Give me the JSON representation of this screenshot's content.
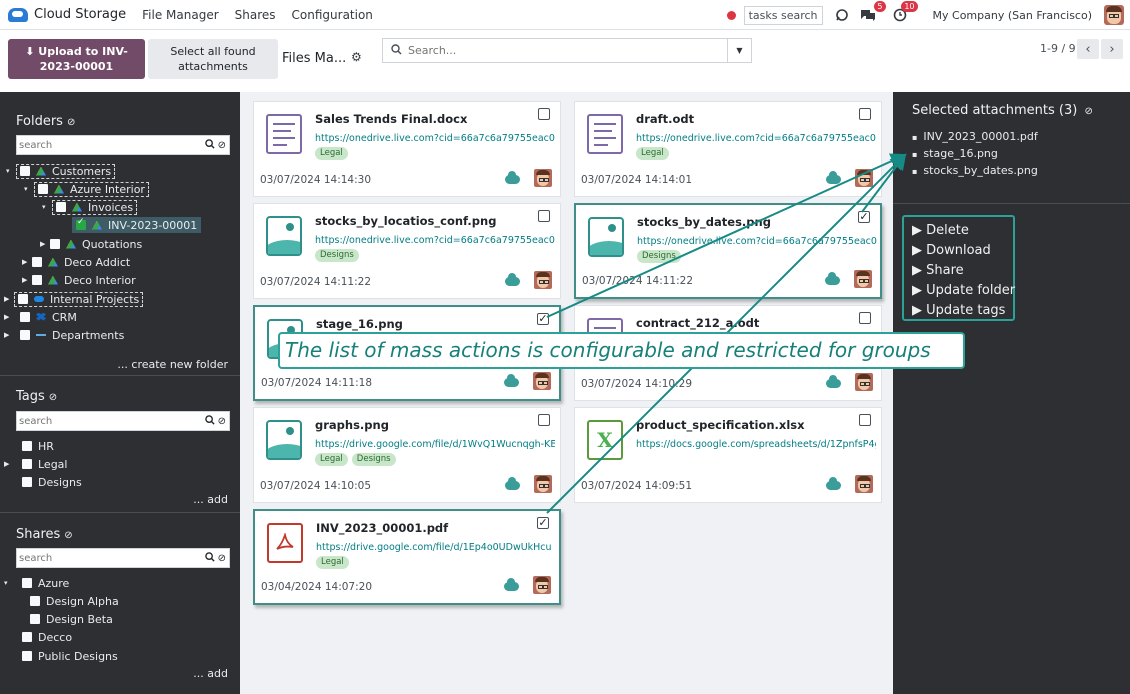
{
  "navbar": {
    "app_name": "Cloud Storage",
    "menus": [
      "File Manager",
      "Shares",
      "Configuration"
    ],
    "tasks_search": "tasks search",
    "messages_count": "5",
    "activity_count": "10",
    "company": "My Company (San Francisco)"
  },
  "control": {
    "upload_label": "Upload to INV-2023-00001",
    "select_all_label": "Select all found attachments",
    "view_title": "Files Ma...",
    "search_placeholder": "Search...",
    "pager": "1-9 / 9"
  },
  "sidebar": {
    "folders": {
      "title": "Folders",
      "search_placeholder": "search",
      "create_link": "... create new folder",
      "items": [
        {
          "label": "Customers"
        },
        {
          "label": "Azure Interior"
        },
        {
          "label": "Invoices"
        },
        {
          "label": "INV-2023-00001"
        },
        {
          "label": "Quotations"
        },
        {
          "label": "Deco Addict"
        },
        {
          "label": "Deco Interior"
        },
        {
          "label": "Internal Projects"
        },
        {
          "label": "CRM"
        },
        {
          "label": "Departments"
        }
      ]
    },
    "tags": {
      "title": "Tags",
      "search_placeholder": "search",
      "add_link": "... add",
      "items": [
        {
          "label": "HR"
        },
        {
          "label": "Legal"
        },
        {
          "label": "Designs"
        }
      ]
    },
    "shares": {
      "title": "Shares",
      "search_placeholder": "search",
      "add_link": "... add",
      "items": [
        {
          "label": "Azure"
        },
        {
          "label": "Design Alpha"
        },
        {
          "label": "Design Beta"
        },
        {
          "label": "Decco"
        },
        {
          "label": "Public Designs"
        }
      ]
    }
  },
  "files": [
    {
      "name": "Sales Trends Final.docx",
      "url": "https://onedrive.live.com?cid=66a7c6a79755eac0&id=",
      "tags": [
        "Legal"
      ],
      "date": "03/07/2024 14:14:30",
      "selected": false,
      "kind": "doc"
    },
    {
      "name": "draft.odt",
      "url": "https://onedrive.live.com?cid=66a7c6a79755eac0&id=",
      "tags": [
        "Legal"
      ],
      "date": "03/07/2024 14:14:01",
      "selected": false,
      "kind": "doc"
    },
    {
      "name": "stocks_by_locatios_conf.png",
      "url": "https://onedrive.live.com?cid=66a7c6a79755eac0&id=",
      "tags": [
        "Designs"
      ],
      "date": "03/07/2024 14:11:22",
      "selected": false,
      "kind": "img"
    },
    {
      "name": "stocks_by_dates.png",
      "url": "https://onedrive.live.com?cid=66a7c6a79755eac0&id=",
      "tags": [
        "Designs"
      ],
      "date": "03/07/2024 14:11:22",
      "selected": true,
      "kind": "img"
    },
    {
      "name": "stage_16.png",
      "url": "",
      "tags": [],
      "date": "03/07/2024 14:11:18",
      "selected": true,
      "kind": "img"
    },
    {
      "name": "contract_212_a.odt",
      "url": "",
      "tags": [],
      "date": "03/07/2024 14:10:29",
      "selected": false,
      "kind": "doc"
    },
    {
      "name": "graphs.png",
      "url": "https://drive.google.com/file/d/1WvQ1Wucnqgh-KEb",
      "tags": [
        "Legal",
        "Designs"
      ],
      "date": "03/07/2024 14:10:05",
      "selected": false,
      "kind": "img"
    },
    {
      "name": "product_specification.xlsx",
      "url": "https://docs.google.com/spreadsheets/d/1ZpnfsP4gH",
      "tags": [],
      "date": "03/07/2024 14:09:51",
      "selected": false,
      "kind": "xls"
    },
    {
      "name": "INV_2023_00001.pdf",
      "url": "https://drive.google.com/file/d/1Ep4o0UDwUkHcu",
      "tags": [
        "Legal"
      ],
      "date": "03/04/2024 14:07:20",
      "selected": true,
      "kind": "pdf"
    }
  ],
  "selected_panel": {
    "title": "Selected attachments (3)",
    "items": [
      "INV_2023_00001.pdf",
      "stage_16.png",
      "stocks_by_dates.png"
    ],
    "actions": [
      "Delete",
      "Download",
      "Share",
      "Update folder",
      "Update tags"
    ]
  },
  "annotation": {
    "text": "The list of mass actions is configurable and restricted for groups"
  },
  "colors": {
    "primary": "#714b67",
    "accent": "#2ba197",
    "sidebar_bg": "#2d2f33"
  }
}
